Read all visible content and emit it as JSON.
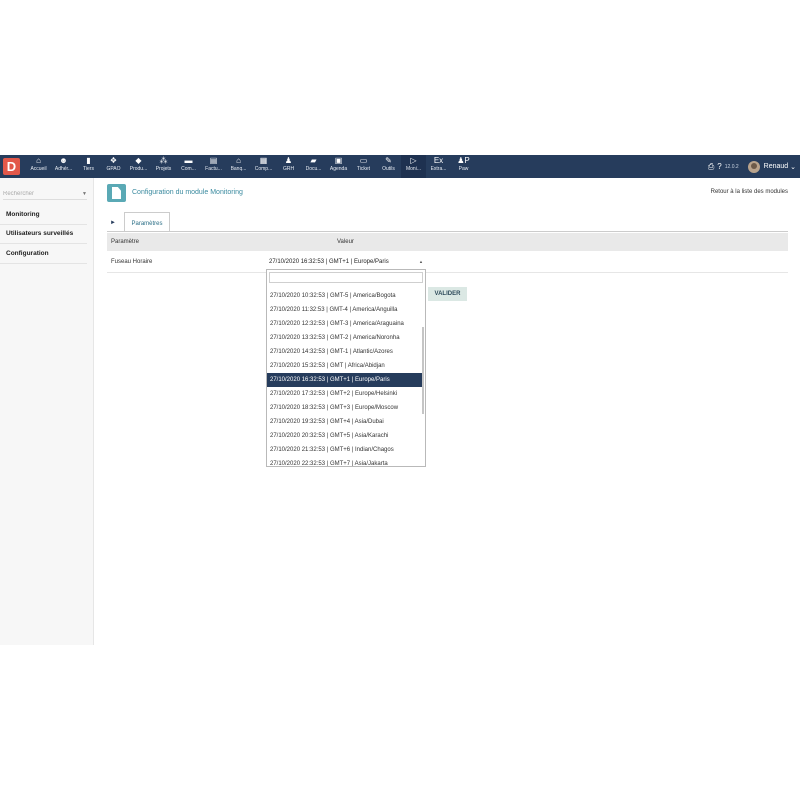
{
  "topbar": {
    "logo": "D",
    "nav": [
      {
        "icon": "home-icon",
        "glyph": "⌂",
        "label": "Accueil"
      },
      {
        "icon": "users-icon",
        "glyph": "☻",
        "label": "Adhér..."
      },
      {
        "icon": "building-icon",
        "glyph": "▮",
        "label": "Tiers"
      },
      {
        "icon": "cubes-icon",
        "glyph": "❖",
        "label": "GPAO"
      },
      {
        "icon": "cube-icon",
        "glyph": "◆",
        "label": "Produ..."
      },
      {
        "icon": "sitemap-icon",
        "glyph": "⁂",
        "label": "Projets"
      },
      {
        "icon": "briefcase-icon",
        "glyph": "▬",
        "label": "Com..."
      },
      {
        "icon": "invoice-icon",
        "glyph": "▤",
        "label": "Factu..."
      },
      {
        "icon": "bank-icon",
        "glyph": "⌂",
        "label": "Banq..."
      },
      {
        "icon": "calculator-icon",
        "glyph": "▦",
        "label": "Comp..."
      },
      {
        "icon": "user-tie-icon",
        "glyph": "♟",
        "label": "GRH"
      },
      {
        "icon": "folder-icon",
        "glyph": "▰",
        "label": "Docu..."
      },
      {
        "icon": "calendar-icon",
        "glyph": "▣",
        "label": "Agenda"
      },
      {
        "icon": "ticket-icon",
        "glyph": "▭",
        "label": "Ticket"
      },
      {
        "icon": "wrench-icon",
        "glyph": "✎",
        "label": "Outils"
      },
      {
        "icon": "monitoring-icon",
        "glyph": "▷",
        "label": "Moni..."
      },
      {
        "icon": "extra-icon",
        "glyph": "Ex",
        "label": "Extra..."
      },
      {
        "icon": "paw-icon",
        "glyph": "♟P",
        "label": "Paw"
      }
    ],
    "active_index": 15,
    "version": "12.0.2",
    "user": "Renaud"
  },
  "sidebar": {
    "search_placeholder": "Rechercher",
    "items": [
      "Monitoring",
      "Utilisateurs surveillés",
      "Configuration"
    ]
  },
  "main": {
    "title": "Configuration du module Monitoring",
    "back_link": "Retour à la liste des modules",
    "tab": "Paramètres",
    "table": {
      "col_param": "Paramètre",
      "col_value": "Valeur",
      "row_param": "Fuseau Horaire",
      "row_value": "27/10/2020 16:32:53 | GMT+1 | Europe/Paris"
    },
    "dropdown_options": [
      "27/10/2020 10:32:53 | GMT-5 | America/Bogota",
      "27/10/2020 11:32:53 | GMT-4 | America/Anguilla",
      "27/10/2020 12:32:53 | GMT-3 | America/Araguaina",
      "27/10/2020 13:32:53 | GMT-2 | America/Noronha",
      "27/10/2020 14:32:53 | GMT-1 | Atlantic/Azores",
      "27/10/2020 15:32:53 | GMT | Africa/Abidjan",
      "27/10/2020 16:32:53 | GMT+1 | Europe/Paris",
      "27/10/2020 17:32:53 | GMT+2 | Europe/Helsinki",
      "27/10/2020 18:32:53 | GMT+3 | Europe/Moscow",
      "27/10/2020 19:32:53 | GMT+4 | Asia/Dubai",
      "27/10/2020 20:32:53 | GMT+5 | Asia/Karachi",
      "27/10/2020 21:32:53 | GMT+6 | Indian/Chagos",
      "27/10/2020 22:32:53 | GMT+7 | Asia/Jakarta"
    ],
    "selected_option_index": 6,
    "validate_label": "VALIDER"
  }
}
